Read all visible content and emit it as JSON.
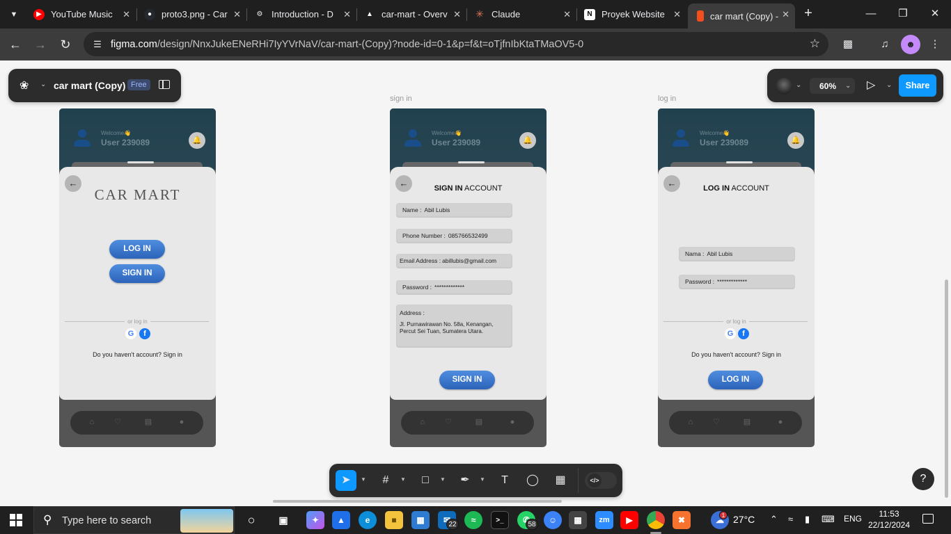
{
  "browser": {
    "tabs": [
      {
        "title": "YouTube Music",
        "icon": "youtube-music-icon",
        "color": "#ff0000"
      },
      {
        "title": "proto3.png - Car",
        "icon": "github-icon",
        "color": "#24292f"
      },
      {
        "title": "Introduction - D",
        "icon": "gear-icon",
        "color": "#3c3c3c"
      },
      {
        "title": "car-mart - Overv",
        "icon": "vercel-icon",
        "color": "#000000"
      },
      {
        "title": "Claude",
        "icon": "claude-icon",
        "color": "#d97757"
      },
      {
        "title": "Proyek Website",
        "icon": "notion-icon",
        "color": "#ffffff"
      },
      {
        "title": "car mart (Copy) -",
        "icon": "figma-icon",
        "color": "#f24e1e"
      }
    ],
    "url_host": "figma.com",
    "url_path": "/design/NnxJukeENeRHi7IyYVrNaV/car-mart-(Copy)?node-id=0-1&p=f&t=oTjfnIbKtaTMaOV5-0"
  },
  "figma": {
    "file_name": "car mart (Copy)",
    "plan_badge": "Free",
    "zoom": "60%",
    "share_label": "Share",
    "help_label": "?"
  },
  "frames": [
    {
      "label": "",
      "welcome": "Welcome👋",
      "user": "User 239089",
      "brand": "CAR MART",
      "login_button": "LOG IN",
      "signin_button": "SIGN IN",
      "or_login": "or log in",
      "have_account": "Do you haven't account? Sign in"
    },
    {
      "label": "sign in",
      "welcome": "Welcome👋",
      "user": "User 239089",
      "title_bold": "SIGN IN",
      "title_rest": " ACCOUNT",
      "fields": [
        {
          "label": "Name :",
          "value": "Abil Lubis"
        },
        {
          "label": "Phone Number :",
          "value": "085766532499"
        },
        {
          "label": "Email Address :",
          "value": "abillubis@gmail.com"
        },
        {
          "label": "Password :",
          "value": "*************"
        }
      ],
      "address_label": "Address :",
      "address_value": "Jl. Purnawirawan No. 58a, Kenangan, Percut Sei Tuan, Sumatera Utara.",
      "submit": "SIGN IN"
    },
    {
      "label": "log in",
      "welcome": "Welcome👋",
      "user": "User 239089",
      "title_bold": "LOG IN",
      "title_rest": " ACCOUNT",
      "fields": [
        {
          "label": "Nama :",
          "value": "Abil Lubis"
        },
        {
          "label": "Password :",
          "value": "*************"
        }
      ],
      "or_login": "or log in",
      "have_account": "Do you haven't account? Sign in",
      "submit": "LOG IN"
    }
  ],
  "taskbar": {
    "search_placeholder": "Type here to search",
    "badges": {
      "mail": "22",
      "whatsapp": "58",
      "weather": "1"
    },
    "temperature": "27°C",
    "language": "ENG",
    "time": "11:53",
    "date": "22/12/2024"
  }
}
